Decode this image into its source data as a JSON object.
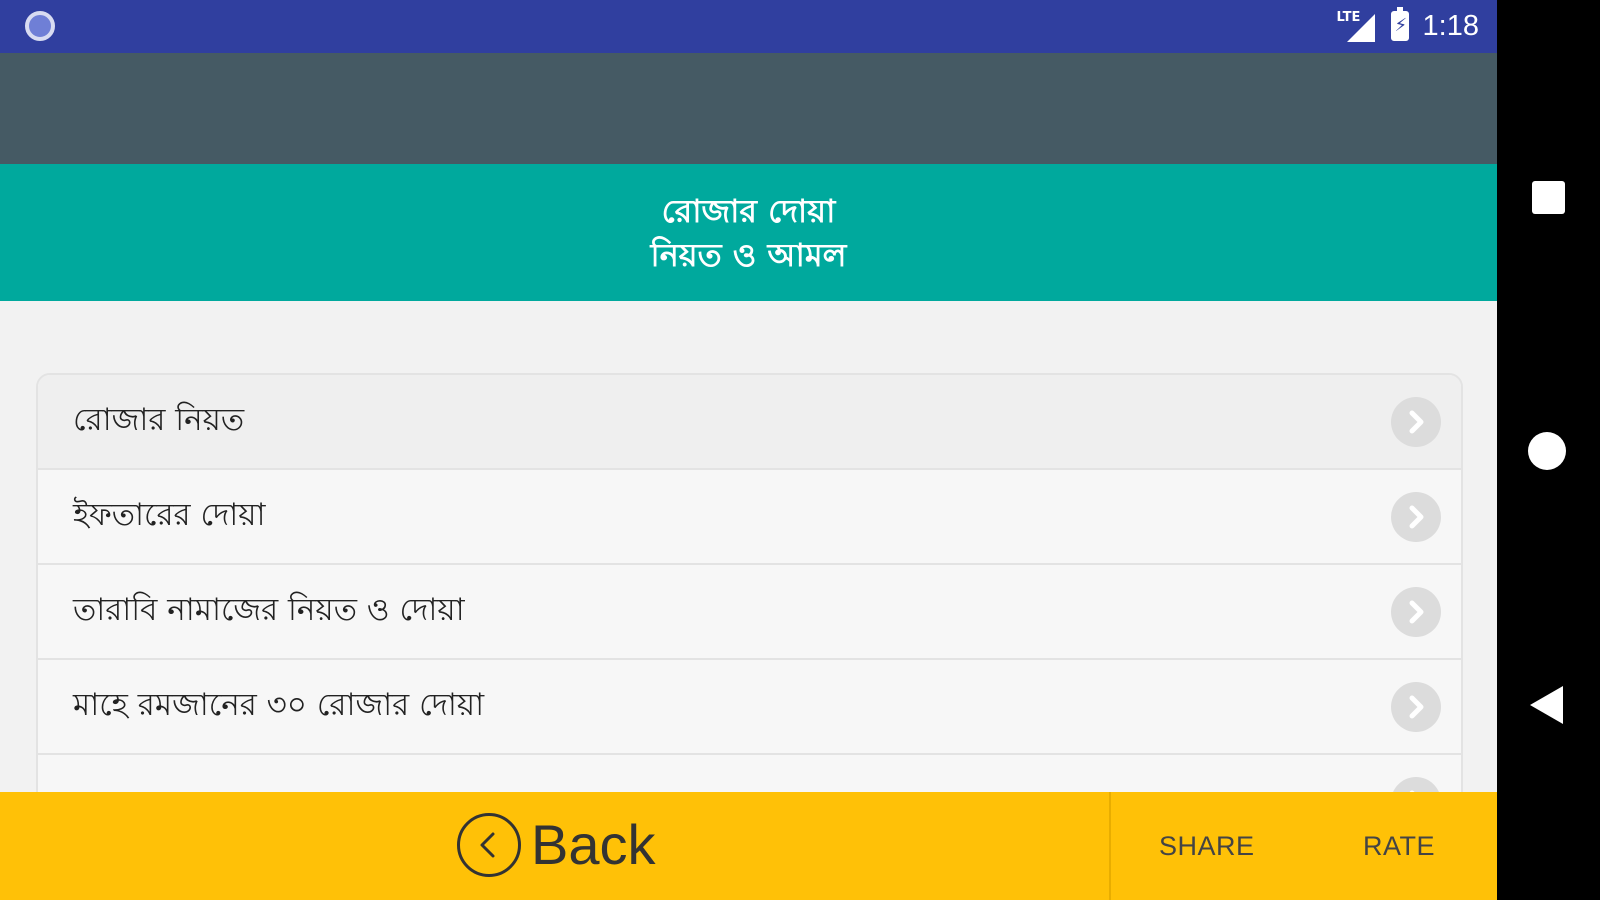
{
  "status_bar": {
    "network_label": "LTE",
    "time": "1:18",
    "icons": [
      "notification-dot-icon",
      "lte-signal-icon",
      "battery-charging-icon"
    ]
  },
  "header": {
    "title_line1": "রোজার দোয়া",
    "title_line2": "নিয়ত ও আমল",
    "banner_color": "#00a99d",
    "action_bar_color": "#455a64",
    "status_bar_color": "#303f9f"
  },
  "list": {
    "items": [
      {
        "label": "রোজার নিয়ত"
      },
      {
        "label": "ইফতারের দোয়া"
      },
      {
        "label": "তারাবি নামাজের নিয়ত ও দোয়া"
      },
      {
        "label": "মাহে রমজানের ৩০ রোজার দোয়া"
      }
    ],
    "chevron_icon": "chevron-right-icon"
  },
  "bottom_bar": {
    "back_label": "Back",
    "share_label": "SHARE",
    "rate_label": "RATE",
    "color": "#ffc107"
  },
  "nav_bar": {
    "icons": [
      "recents-square-icon",
      "home-circle-icon",
      "back-triangle-icon"
    ]
  }
}
